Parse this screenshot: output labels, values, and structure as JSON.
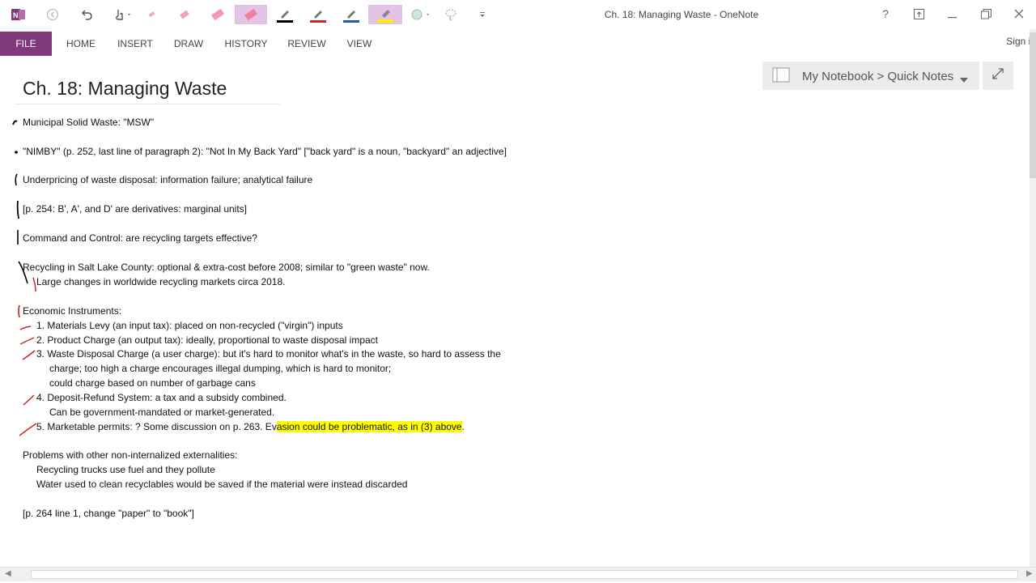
{
  "app": {
    "window_title": "Ch. 18: Managing Waste - OneNote",
    "sign_in": "Sign in",
    "accent_color": "#80397b"
  },
  "quick_access": [
    {
      "name": "onenote-logo-icon"
    },
    {
      "name": "back-icon"
    },
    {
      "name": "undo-icon"
    },
    {
      "name": "touch-mode-icon"
    },
    {
      "name": "eraser-small-icon"
    },
    {
      "name": "eraser-medium-icon"
    },
    {
      "name": "eraser-large-icon"
    },
    {
      "name": "eraser-selected-icon"
    },
    {
      "name": "pen-black-icon"
    },
    {
      "name": "pen-red-icon"
    },
    {
      "name": "pen-blue-icon"
    },
    {
      "name": "highlighter-yellow-icon"
    },
    {
      "name": "shape-icon"
    },
    {
      "name": "lasso-icon"
    },
    {
      "name": "customize-icon"
    }
  ],
  "ribbon": {
    "tabs": [
      "FILE",
      "HOME",
      "INSERT",
      "DRAW",
      "HISTORY",
      "REVIEW",
      "VIEW"
    ]
  },
  "notebook": {
    "label": "My Notebook > Quick Notes"
  },
  "page": {
    "title": "Ch. 18: Managing Waste",
    "lines": [
      "Municipal Solid Waste: \"MSW\"",
      "\"NIMBY\" (p. 252, last line of paragraph 2): \"Not In My Back Yard\" [\"back yard\" is a noun, \"backyard\" an adjective]",
      "Underpricing of waste disposal: information failure; analytical failure",
      "[p. 254: B', A', and D' are derivatives: marginal units]",
      "Command and Control: are recycling targets effective?",
      "Recycling in Salt Lake County: optional & extra-cost before 2008; similar to \"green waste\" now.",
      "Large changes in worldwide recycling markets circa 2018.",
      "Economic Instruments:",
      "1. Materials Levy (an input tax): placed on non-recycled (\"virgin\") inputs",
      "2. Product Charge (an output tax): ideally, proportional to waste disposal impact",
      "3. Waste Disposal Charge (a user charge): but it's hard to monitor what's in the waste, so hard to assess the",
      "charge; too high a charge encourages illegal dumping, which is hard to monitor;",
      "could charge based on number of garbage cans",
      "4. Deposit-Refund System: a tax and a subsidy combined.",
      "Can be government-mandated or market-generated.",
      "5. Marketable permits: ?  Some discussion on p. 263.  Ev",
      "asion could be problematic, as in (3) above",
      ".",
      "Problems with other non-internalized externalities:",
      "Recycling trucks use fuel and they pollute",
      "Water used to clean recyclables would be saved if the material were instead discarded",
      "[p. 264 line 1, change \"paper\" to \"book\"]"
    ]
  }
}
